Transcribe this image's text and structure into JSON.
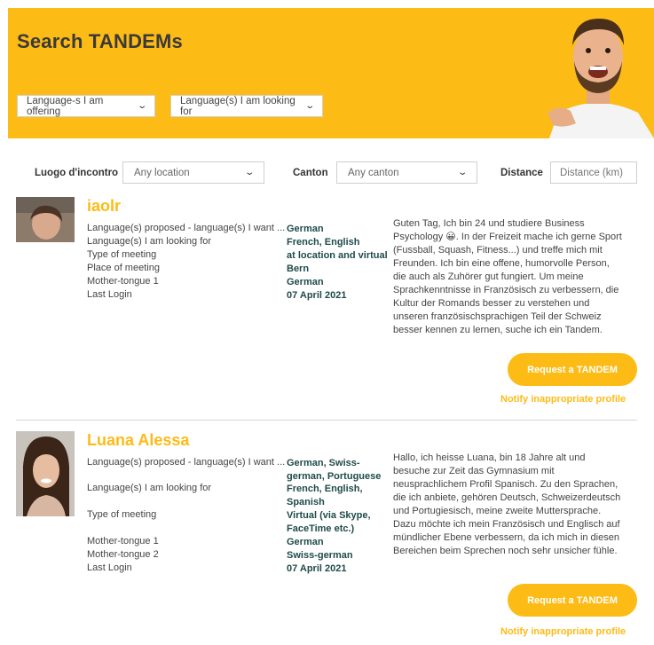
{
  "header": {
    "title": "Search TANDEMs",
    "offering_select": "Language-s I am offering",
    "looking_select": "Language(s) I am looking for"
  },
  "filters": {
    "location_label": "Luogo d'incontro",
    "location_value": "Any location",
    "canton_label": "Canton",
    "canton_value": "Any canton",
    "distance_label": "Distance",
    "distance_placeholder": "Distance (km)"
  },
  "profiles": [
    {
      "name": "iaolr",
      "labels": [
        "Language(s) proposed - language(s) I want ...",
        "Language(s) I am looking for",
        "Type of meeting",
        "Place of meeting",
        "Mother-tongue 1",
        "Last Login"
      ],
      "values": [
        "German",
        "French, English",
        "at location and virtual",
        "Bern",
        "German",
        "07 April 2021"
      ],
      "description": "Guten Tag, Ich bin 24 und studiere Business Psychology 😀. In der Freizeit mache ich gerne Sport (Fussball, Squash, Fitness...) und treffe mich mit Freunden. Ich bin eine offene, humorvolle Person, die auch als Zuhörer gut fungiert. Um meine Sprachkenntnisse in Französisch zu verbessern, die Kultur der Romands besser zu verstehen und unseren französischsprachigen Teil der Schweiz besser kennen zu lernen, suche ich ein Tandem.",
      "request_label": "Request a TANDEM",
      "notify_label": "Notify inappropriate profile"
    },
    {
      "name": "Luana Alessa",
      "labels": [
        "Language(s) proposed - language(s) I want ...",
        "Language(s) I am looking for",
        "Type of meeting",
        "Mother-tongue 1",
        "Mother-tongue 2",
        "Last Login"
      ],
      "values": [
        "German, Swiss-german, Portuguese",
        "French, English, Spanish",
        "Virtual (via Skype, FaceTime etc.)",
        "German",
        "Swiss-german",
        "07 April 2021"
      ],
      "description": "Hallo, ich heisse Luana, bin 18 Jahre alt und besuche zur Zeit das Gymnasium mit neusprachlichem Profil Spanisch. Zu den Sprachen, die ich anbiete, gehören Deutsch, Schweizerdeutsch und Portugiesisch, meine zweite Muttersprache. Dazu möchte ich mein Französisch und Englisch auf mündlicher Ebene verbessern, da ich mich in diesen Bereichen beim Sprechen noch sehr unsicher fühle.",
      "request_label": "Request a TANDEM",
      "notify_label": "Notify inappropriate profile"
    }
  ],
  "colors": {
    "accent": "#fdbb16",
    "value_text": "#1f4a4a"
  }
}
